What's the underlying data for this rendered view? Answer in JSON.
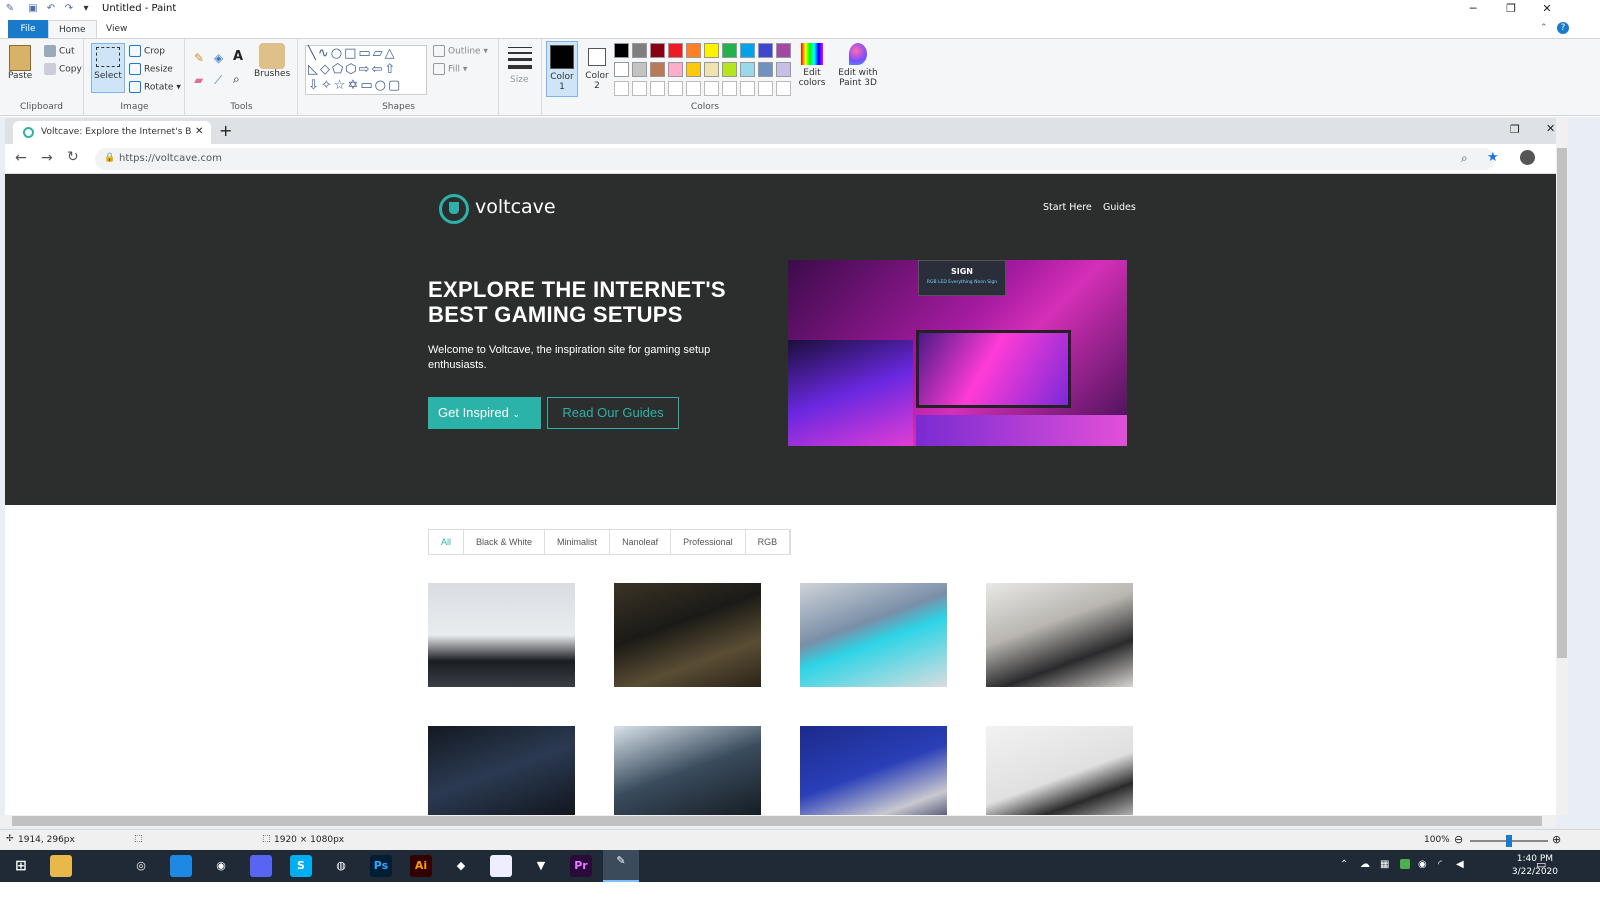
{
  "window": {
    "title": "Untitled - Paint"
  },
  "ribbon": {
    "tabs": [
      "File",
      "Home",
      "View"
    ],
    "clipboard": {
      "paste": "Paste",
      "cut": "Cut",
      "copy": "Copy",
      "label": "Clipboard"
    },
    "image": {
      "select": "Select",
      "crop": "Crop",
      "resize": "Resize",
      "rotate": "Rotate",
      "label": "Image"
    },
    "tools": {
      "label": "Tools",
      "brushes": "Brushes"
    },
    "shapes": {
      "outline": "Outline",
      "fill": "Fill",
      "label": "Shapes"
    },
    "size": {
      "label": "Size"
    },
    "color1": {
      "label": "Color 1",
      "value": "#000000"
    },
    "color2": {
      "label": "Color 2",
      "value": "#ffffff"
    },
    "colors": {
      "label": "Colors",
      "edit": "Edit colors",
      "palette": [
        "#000000",
        "#7f7f7f",
        "#880015",
        "#ed1c24",
        "#ff7f27",
        "#fff200",
        "#22b14c",
        "#00a2e8",
        "#3f48cc",
        "#a349a4",
        "#ffffff",
        "#c3c3c3",
        "#b97a57",
        "#ffaec9",
        "#ffc90e",
        "#efe4b0",
        "#b5e61d",
        "#99d9ea",
        "#7092be",
        "#c8bfe7"
      ]
    },
    "paint3d": "Edit with Paint 3D"
  },
  "browser": {
    "tab_title": "Voltcave: Explore the Internet's B",
    "url": "https://voltcave.com"
  },
  "site": {
    "logo": "voltcave",
    "nav": [
      "Start Here",
      "Guides"
    ],
    "headline": "EXPLORE THE INTERNET'S BEST GAMING SETUPS",
    "lead": "Welcome to Voltcave, the inspiration site for gaming setup enthusiasts.",
    "cta_primary": "Get Inspired",
    "cta_secondary": "Read Our Guides",
    "hero_img_sign": "SIGN",
    "hero_img_caption": "RGB LED Everything Neon Sign",
    "filters": [
      "All",
      "Black & White",
      "Minimalist",
      "Nanoleaf",
      "Professional",
      "RGB"
    ],
    "accent": "#2bb3a9",
    "hero_bg": "#2c2e2d"
  },
  "status": {
    "cursor": "1914, 296px",
    "size": "1920 × 1080px",
    "zoom": "100%"
  },
  "taskbar": {
    "time": "1:40 PM",
    "date": "3/22/2020"
  }
}
